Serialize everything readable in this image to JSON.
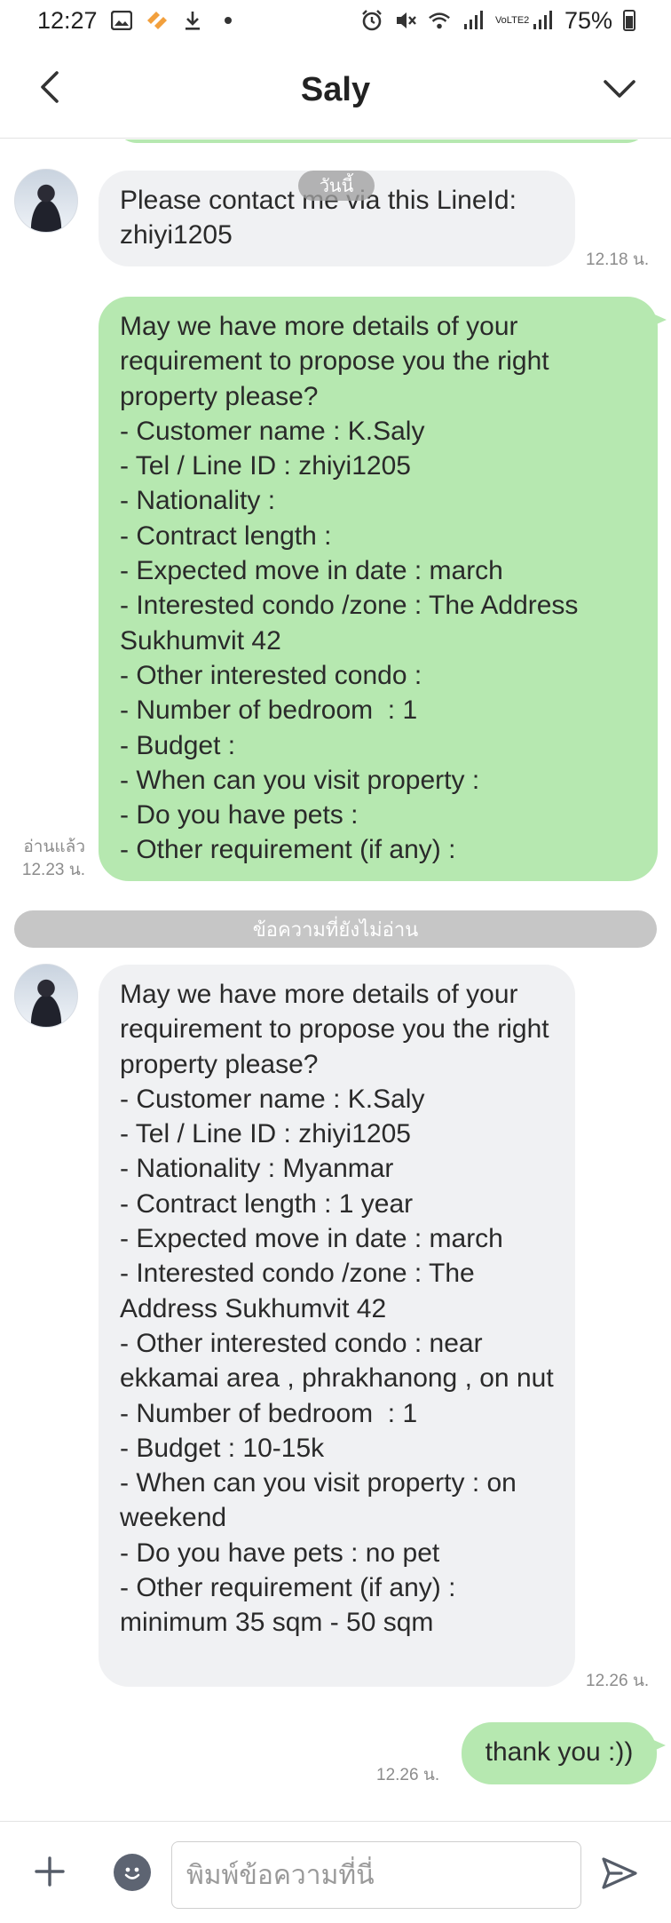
{
  "status_bar": {
    "time": "12:27",
    "battery": "75%",
    "network": "VoLTE2"
  },
  "header": {
    "title": "Saly"
  },
  "chat": {
    "date_label": "วันนี้",
    "unread_divider": "ข้อความที่ยังไม่อ่าน",
    "messages": [
      {
        "direction": "incoming",
        "text": "Please contact me via this LineId:\nzhiyi1205",
        "time": "12.18 น."
      },
      {
        "direction": "outgoing",
        "text": "May we have more details of your requirement to propose you the right property please?\n- Customer name : K.Saly\n- Tel / Line ID : zhiyi1205\n- Nationality :\n- Contract length :\n- Expected move in date : march\n- Interested condo /zone : The Address Sukhumvit 42\n- Other interested condo :\n- Number of bedroom  : 1\n- Budget :\n- When can you visit property :\n- Do you have pets :\n- Other requirement (if any) :",
        "time": "12.23 น.",
        "read_label": "อ่านแล้ว"
      },
      {
        "direction": "incoming",
        "text": "May we have more details of your requirement to propose you the right property please?\n- Customer name : K.Saly\n- Tel / Line ID : zhiyi1205\n- Nationality : Myanmar\n- Contract length : 1 year\n- Expected move in date : march\n- Interested condo /zone : The Address Sukhumvit 42\n- Other interested condo : near ekkamai area , phrakhanong , on nut\n- Number of bedroom  : 1\n- Budget : 10-15k\n- When can you visit property : on weekend\n- Do you have pets : no pet\n- Other requirement (if any) : minimum 35 sqm - 50 sqm",
        "time": "12.26 น."
      },
      {
        "direction": "outgoing",
        "text": "thank you :))",
        "time": "12.26 น."
      }
    ]
  },
  "input_bar": {
    "placeholder": "พิมพ์ข้อความที่นี่"
  }
}
